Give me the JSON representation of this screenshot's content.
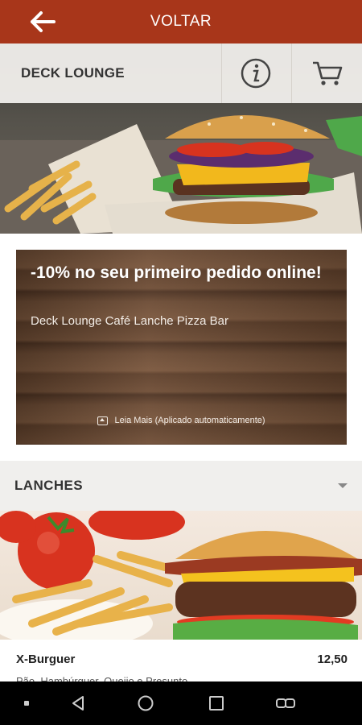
{
  "topbar": {
    "back_icon": "arrow-left-icon",
    "title": "VOLTAR",
    "color": "#a8361a"
  },
  "restaurant": {
    "name": "DECK LOUNGE",
    "info_icon": "info-icon",
    "cart_icon": "cart-icon"
  },
  "promo": {
    "title": "-10% no seu primeiro pedido online!",
    "subtitle": "Deck Lounge Café Lanche Pizza Bar",
    "read_more": "Leia Mais (Aplicado automaticamente)"
  },
  "section": {
    "title": "LANCHES",
    "expand_icon": "chevron-down-icon"
  },
  "product": {
    "name": "X-Burguer",
    "price": "12,50",
    "description": "Pão, Hambúrguer, Queijo e Presunto"
  },
  "navbar": {
    "icons": [
      "dot-icon",
      "back-icon",
      "home-icon",
      "recents-icon",
      "switch-icon"
    ]
  }
}
